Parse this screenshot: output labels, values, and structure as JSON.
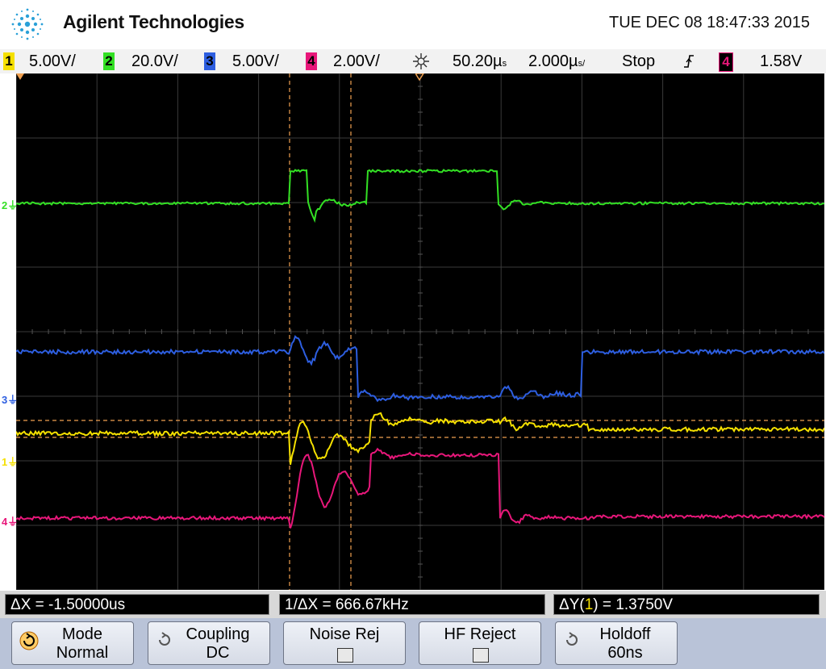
{
  "header": {
    "brand": "Agilent Technologies",
    "datetime": "TUE DEC 08 18:47:33 2015"
  },
  "channels": [
    {
      "num": "1",
      "scale": "5.00V/",
      "color": "#f5e000"
    },
    {
      "num": "2",
      "scale": "20.0V/",
      "color": "#33e024"
    },
    {
      "num": "3",
      "scale": "5.00V/",
      "color": "#2d5ee0"
    },
    {
      "num": "4",
      "scale": "2.00V/",
      "color": "#e8177a"
    }
  ],
  "timebase": {
    "delay": "50.20µ",
    "delay_unit": "s",
    "scale": "2.000µ",
    "scale_unit": "s/",
    "run_state": "Stop",
    "trigger_source": "4",
    "trigger_level": "1.58V"
  },
  "measurements": {
    "delta_x": "ΔX = -1.50000us",
    "inv_delta_x": "1/ΔX = 666.67kHz",
    "delta_y_prefix": "ΔY(",
    "delta_y_channel": "1",
    "delta_y_suffix": ") = 1.3750V"
  },
  "softkeys": [
    {
      "title": "Mode",
      "value": "Normal",
      "icon": "rotate-arrow-icon"
    },
    {
      "title": "Coupling",
      "value": "DC",
      "icon": "rotate-arrow-icon"
    },
    {
      "title": "Noise Rej",
      "value": "",
      "icon": "checkbox-icon"
    },
    {
      "title": "HF Reject",
      "value": "",
      "icon": "checkbox-icon"
    },
    {
      "title": "Holdoff",
      "value": "60ns",
      "icon": "rotate-arrow-icon"
    }
  ],
  "marker_labels": {
    "ch1": "1",
    "ch2": "2",
    "ch3": "3",
    "ch4": "4"
  },
  "colors": {
    "ch1": "#f5e000",
    "ch2": "#33e024",
    "ch3": "#2d5ee0",
    "ch4": "#e8177a",
    "cursor": "#f0a050"
  }
}
